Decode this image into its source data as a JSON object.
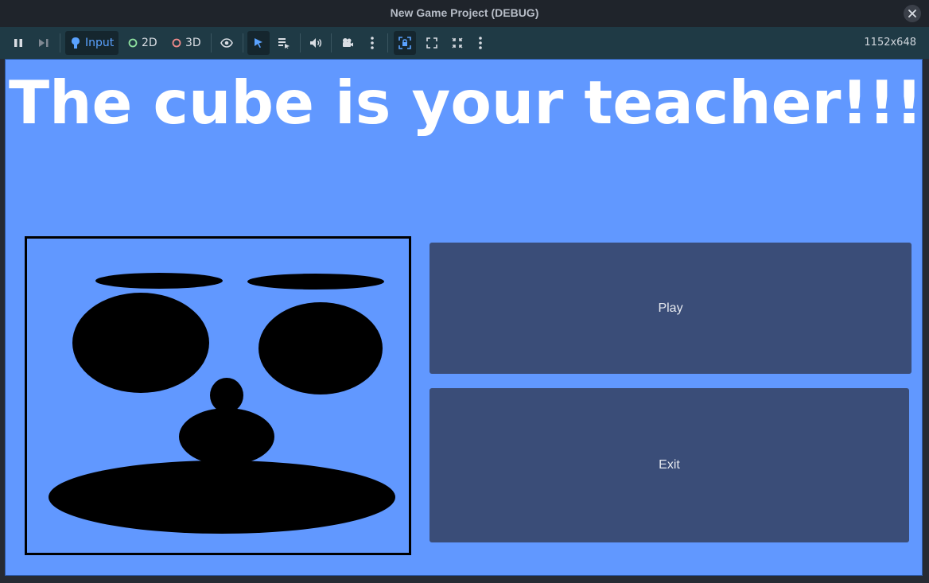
{
  "window": {
    "title": "New Game Project (DEBUG)"
  },
  "toolbar": {
    "input_label": "Input",
    "mode_2d_label": "2D",
    "mode_3d_label": "3D",
    "resolution": "1152x648"
  },
  "game": {
    "headline": "The cube is your teacher!!!",
    "play_label": "Play",
    "exit_label": "Exit"
  },
  "colors": {
    "background": "#6198ff",
    "button": "#3a4d78",
    "accent_2d": "#8fe2a0",
    "accent_3d": "#f08a8a",
    "accent_blue": "#5aa2ff"
  },
  "icons": {
    "pause": "pause-icon",
    "step": "step-frame-icon",
    "input": "input-icon",
    "visibility": "eye-icon",
    "select": "cursor-icon",
    "list": "node-list-icon",
    "audio": "speaker-icon",
    "camera": "camera-icon",
    "menu": "kebab-menu-icon",
    "fullscreen": "fullscreen-icon"
  }
}
